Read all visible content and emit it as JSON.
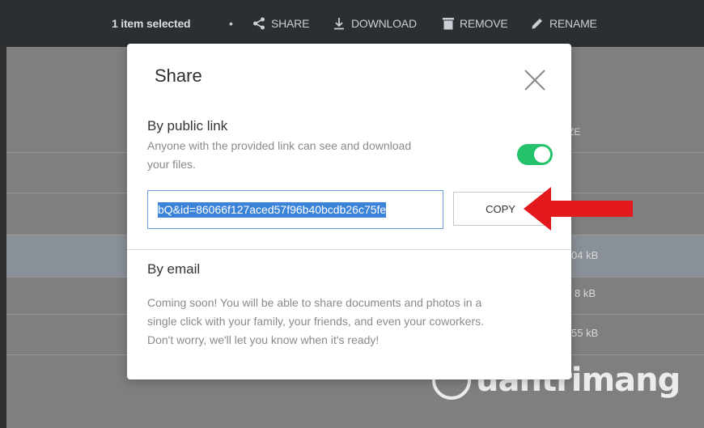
{
  "toolbar": {
    "selection": "1 item selected",
    "separator": "•",
    "share": "SHARE",
    "download": "DOWNLOAD",
    "remove": "REMOVE",
    "rename": "RENAME"
  },
  "background": {
    "column_fragment": "ZE",
    "sizes": [
      "04 kB",
      "8 kB",
      "55 kB"
    ]
  },
  "modal": {
    "title": "Share",
    "public_link": {
      "heading": "By public link",
      "description_line1": "Anyone with the provided link can see and download",
      "description_line2": "your files.",
      "toggle_on": true,
      "link_value": "bQ&id=86066f127aced57f96b40bcdb26c75fe",
      "copy_label": "COPY"
    },
    "email": {
      "heading": "By email",
      "line1": "Coming soon! You will be able to share documents and photos in a",
      "line2": "single click with your family, your friends, and even your coworkers.",
      "line3": "Don't worry, we'll let you know when it's ready!"
    }
  },
  "watermark": "uantrimang",
  "colors": {
    "toggle": "#23c26b",
    "selection": "#3b82d9",
    "arrow": "#e3191e"
  }
}
